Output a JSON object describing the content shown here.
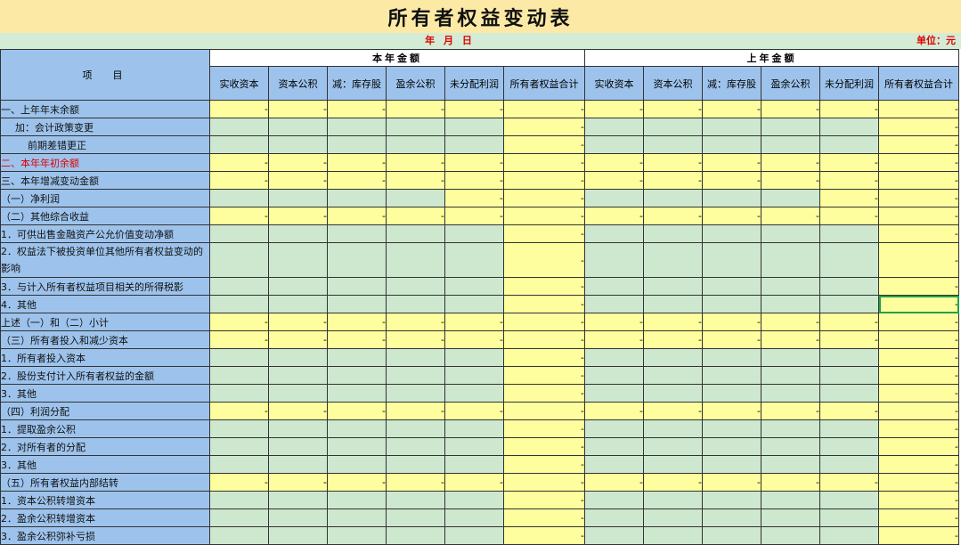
{
  "title": "所有者权益变动表",
  "date_label": "年 月 日",
  "unit_label": "单位：元",
  "header": {
    "item": "项　目",
    "current_year": "本年金额",
    "previous_year": "上年金额",
    "columns": [
      "实收资本",
      "资本公积",
      "减：库存股",
      "盈余公积",
      "未分配利润",
      "所有者权益合计"
    ]
  },
  "empty_value": "-",
  "rows": [
    {
      "label": "一、上年年末余额",
      "pattern": "yyyyyy"
    },
    {
      "label": "加：会计政策变更",
      "pattern": "gggggy",
      "indent": 1
    },
    {
      "label": "前期差错更正",
      "pattern": "gggggy",
      "indent": 2
    },
    {
      "label": "二、本年年初余额",
      "pattern": "yyyyyy",
      "red": true
    },
    {
      "label": "三、本年增减变动金额",
      "pattern": "yyyyyy"
    },
    {
      "label": "（一）净利润",
      "pattern": "ggggyy"
    },
    {
      "label": "（二）其他综合收益",
      "pattern": "yyyyyy"
    },
    {
      "label": "1．可供出售金融资产公允价值变动净额",
      "pattern": "gggggy"
    },
    {
      "label": "2．权益法下被投资单位其他所有者权益变动的影响",
      "pattern": "gggggy",
      "tall": true
    },
    {
      "label": "3．与计入所有者权益项目相关的所得税影",
      "pattern": "gggggy"
    },
    {
      "label": "4．其他",
      "pattern": "gggggy"
    },
    {
      "label": "上述（一）和（二）小计",
      "pattern": "yyyyyy"
    },
    {
      "label": "（三）所有者投入和减少资本",
      "pattern": "yyyyyy"
    },
    {
      "label": "1．所有者投入资本",
      "pattern": "gggggy"
    },
    {
      "label": "2．股份支付计入所有者权益的金额",
      "pattern": "gggggy"
    },
    {
      "label": "3．其他",
      "pattern": "gggggy"
    },
    {
      "label": "（四）利润分配",
      "pattern": "yyyyyy"
    },
    {
      "label": "1．提取盈余公积",
      "pattern": "gggggy"
    },
    {
      "label": "2．对所有者的分配",
      "pattern": "gggggy"
    },
    {
      "label": "3．其他",
      "pattern": "gggggy"
    },
    {
      "label": "（五）所有者权益内部结转",
      "pattern": "yyyyyy"
    },
    {
      "label": "1．资本公积转增资本",
      "pattern": "gggggy"
    },
    {
      "label": "2．盈余公积转增资本",
      "pattern": "gggggy"
    },
    {
      "label": "3．盈余公积弥补亏损",
      "pattern": "gggggy"
    }
  ],
  "colors": {
    "label_blue": "#9dc3ec",
    "input_yellow": "#fefe9e",
    "locked_green": "#cde8cf",
    "title_bg": "#fde9a6",
    "accent_red": "#e00000"
  }
}
